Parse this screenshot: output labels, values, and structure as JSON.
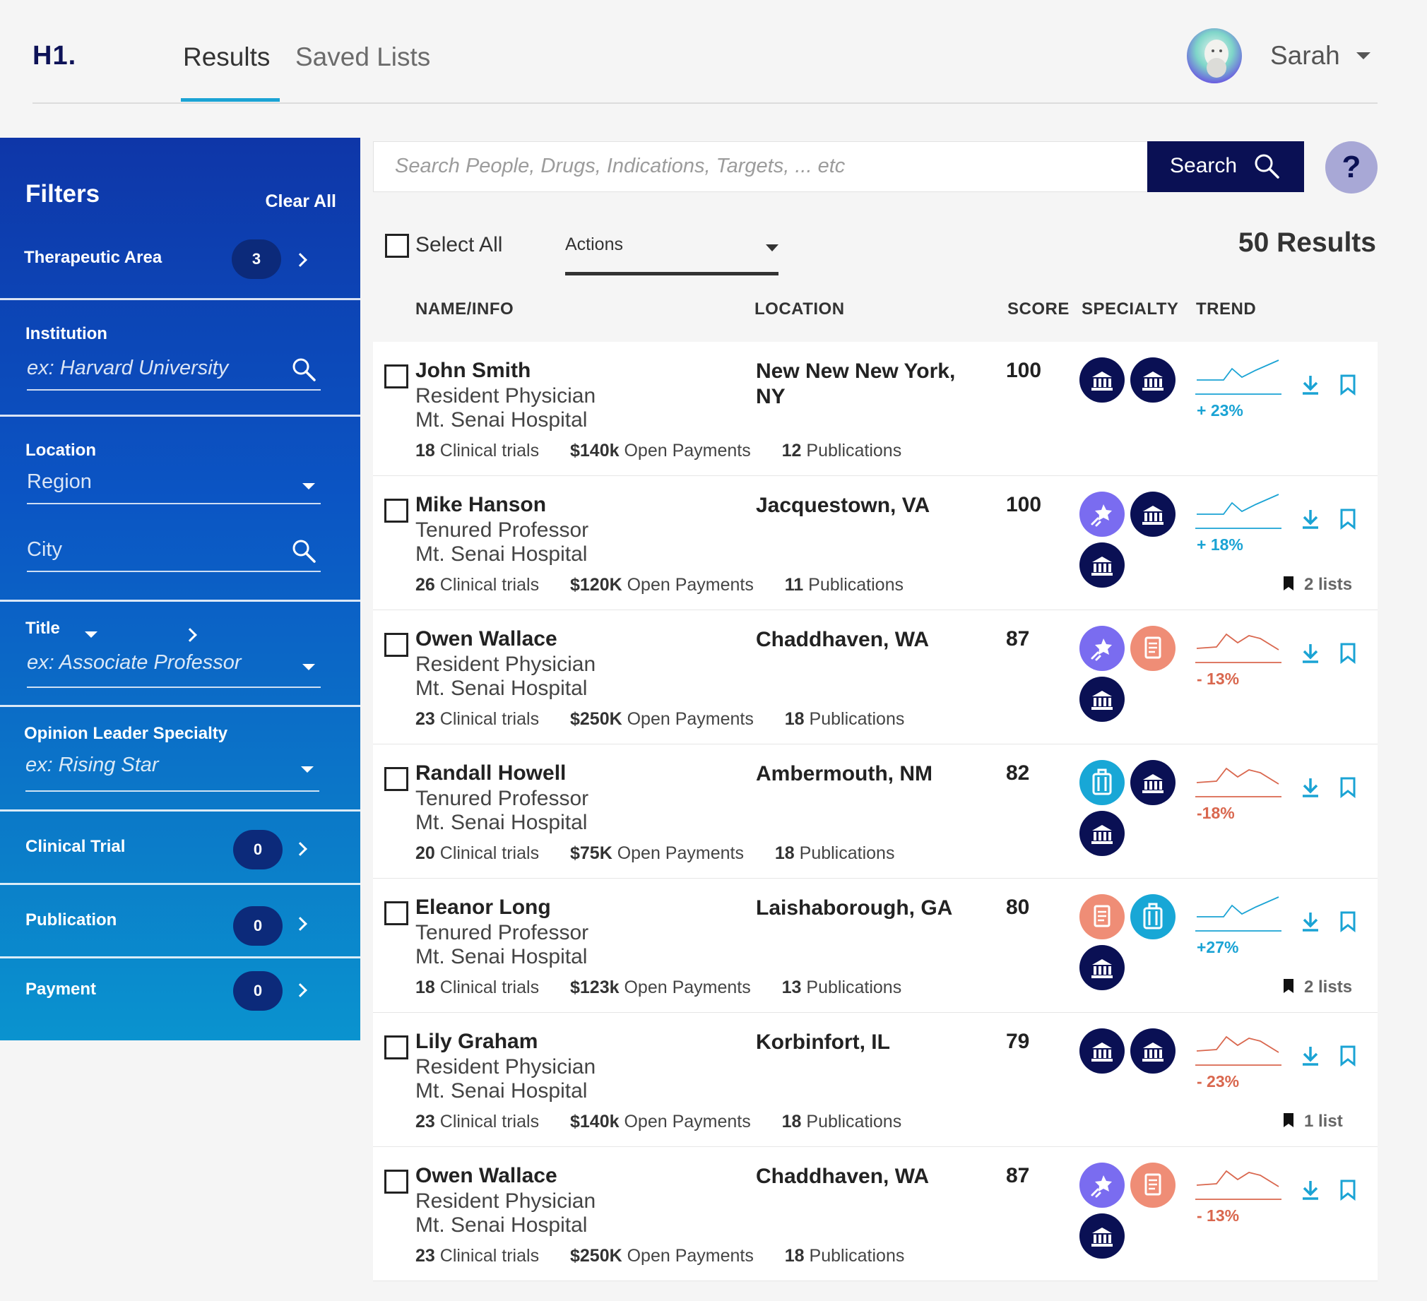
{
  "app": {
    "logo": "H1."
  },
  "nav": {
    "tabs": [
      "Results",
      "Saved Lists"
    ]
  },
  "user": {
    "name": "Sarah"
  },
  "search": {
    "placeholder": "Search People, Drugs, Indications, Targets, ... etc",
    "button_label": "Search",
    "help_label": "?"
  },
  "filters": {
    "title": "Filters",
    "clear_label": "Clear All",
    "therapeutic_area": {
      "label": "Therapeutic Area",
      "count": "3"
    },
    "institution": {
      "label": "Institution",
      "placeholder": "ex: Harvard University"
    },
    "location": {
      "label": "Location",
      "region": "Region",
      "city": "City"
    },
    "title_filter": {
      "label": "Title",
      "placeholder": "ex: Associate Professor"
    },
    "opinion_leader": {
      "label": "Opinion Leader Specialty",
      "placeholder": "ex: Rising Star"
    },
    "clinical_trial": {
      "label": "Clinical Trial",
      "count": "0"
    },
    "publication": {
      "label": "Publication",
      "count": "0"
    },
    "payment": {
      "label": "Payment",
      "count": "0"
    }
  },
  "toolbar": {
    "select_all": "Select All",
    "actions": "Actions",
    "results_count": "50 Results"
  },
  "columns": {
    "name": "NAME/INFO",
    "location": "LOCATION",
    "score": "SCORE",
    "specialty": "SPECIALTY",
    "trend": "TREND"
  },
  "colors": {
    "up": "#1aa3d4",
    "down": "#d9674e",
    "institution_icon": "#0a1054",
    "star_icon": "#7a6cf0",
    "document_icon": "#ef8d76",
    "luggage_icon": "#18a7d6"
  },
  "rows": [
    {
      "name": "John Smith",
      "title": "Resident Physician",
      "institution": "Mt. Senai Hospital",
      "location": "New New New York, NY",
      "score": "100",
      "clinical_trials": "18",
      "clinical_label": "Clinical trials",
      "payments": "$140k",
      "payments_label": "Open Payments",
      "publications": "12",
      "publications_label": "Publications",
      "specialty_icons": [
        "institution-icon",
        "institution-icon"
      ],
      "trend": "+ 23%",
      "trend_dir": "up",
      "lists": ""
    },
    {
      "name": "Mike Hanson",
      "title": "Tenured Professor",
      "institution": "Mt. Senai Hospital",
      "location": "Jacquestown, VA",
      "score": "100",
      "clinical_trials": "26",
      "clinical_label": "Clinical trials",
      "payments": "$120K",
      "payments_label": "Open Payments",
      "publications": "11",
      "publications_label": "Publications",
      "specialty_icons": [
        "star-icon",
        "institution-icon",
        "institution-icon"
      ],
      "trend": "+ 18%",
      "trend_dir": "up",
      "lists": "2 lists"
    },
    {
      "name": "Owen Wallace",
      "title": "Resident Physician",
      "institution": "Mt. Senai Hospital",
      "location": "Chaddhaven, WA",
      "score": "87",
      "clinical_trials": "23",
      "clinical_label": "Clinical trials",
      "payments": "$250K",
      "payments_label": "Open Payments",
      "publications": "18",
      "publications_label": "Publications",
      "specialty_icons": [
        "star-icon",
        "document-icon",
        "institution-icon"
      ],
      "trend": "- 13%",
      "trend_dir": "down",
      "lists": ""
    },
    {
      "name": "Randall Howell",
      "title": "Tenured Professor",
      "institution": "Mt. Senai Hospital",
      "location": "Ambermouth, NM",
      "score": "82",
      "clinical_trials": "20",
      "clinical_label": "Clinical trials",
      "payments": "$75K",
      "payments_label": "Open Payments",
      "publications": "18",
      "publications_label": "Publications",
      "specialty_icons": [
        "luggage-icon",
        "institution-icon",
        "institution-icon"
      ],
      "trend": "-18%",
      "trend_dir": "down",
      "lists": ""
    },
    {
      "name": "Eleanor Long",
      "title": "Tenured Professor",
      "institution": "Mt. Senai Hospital",
      "location": "Laishaborough, GA",
      "score": "80",
      "clinical_trials": "18",
      "clinical_label": "Clinical trials",
      "payments": "$123k",
      "payments_label": "Open Payments",
      "publications": "13",
      "publications_label": "Publications",
      "specialty_icons": [
        "document-icon",
        "luggage-icon",
        "institution-icon"
      ],
      "trend": "+27%",
      "trend_dir": "up",
      "lists": "2 lists"
    },
    {
      "name": "Lily Graham",
      "title": "Resident Physician",
      "institution": "Mt. Senai Hospital",
      "location": "Korbinfort, IL",
      "score": "79",
      "clinical_trials": "23",
      "clinical_label": "Clinical trials",
      "payments": "$140k",
      "payments_label": "Open Payments",
      "publications": "18",
      "publications_label": "Publications",
      "specialty_icons": [
        "institution-icon",
        "institution-icon"
      ],
      "trend": "- 23%",
      "trend_dir": "down",
      "lists": "1 list"
    },
    {
      "name": "Owen Wallace",
      "title": "Resident Physician",
      "institution": "Mt. Senai Hospital",
      "location": "Chaddhaven, WA",
      "score": "87",
      "clinical_trials": "23",
      "clinical_label": "Clinical trials",
      "payments": "$250K",
      "payments_label": "Open Payments",
      "publications": "18",
      "publications_label": "Publications",
      "specialty_icons": [
        "star-icon",
        "document-icon",
        "institution-icon"
      ],
      "trend": "- 13%",
      "trend_dir": "down",
      "lists": ""
    }
  ]
}
